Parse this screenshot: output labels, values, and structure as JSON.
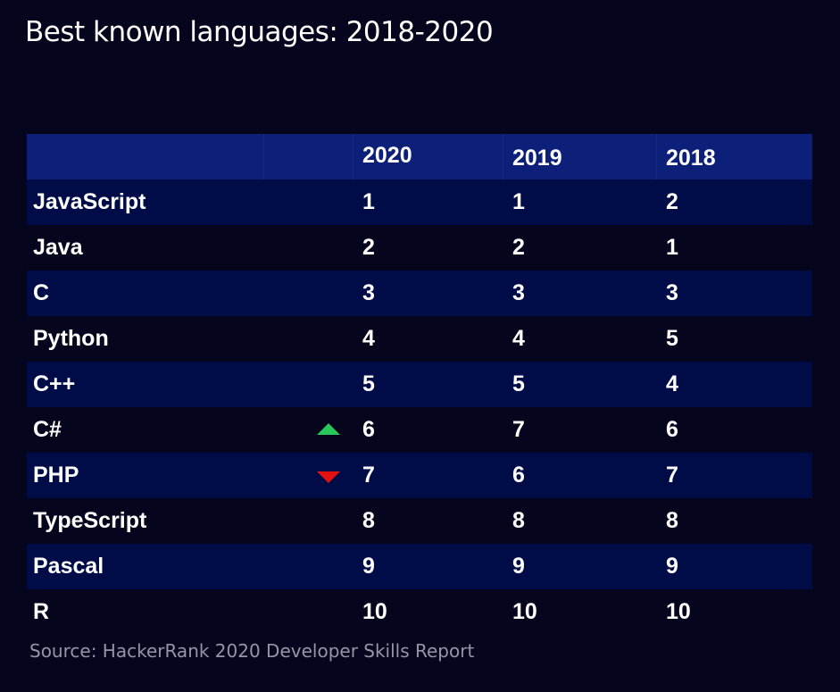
{
  "title": "Best known languages: 2018-2020",
  "source": "Source: HackerRank 2020 Developer Skills Report",
  "colors": {
    "background": "#05051e",
    "header": "#0c2079",
    "band": "#000c48",
    "up": "#27c75a",
    "down": "#e41111"
  },
  "chart_data": {
    "type": "table",
    "title": "Best known languages: 2018-2020",
    "columns": [
      "",
      "2020",
      "2019",
      "2018"
    ],
    "rows": [
      {
        "language": "JavaScript",
        "r2020": "1",
        "r2019": "1",
        "r2018": "2",
        "trend": ""
      },
      {
        "language": "Java",
        "r2020": "2",
        "r2019": "2",
        "r2018": "1",
        "trend": ""
      },
      {
        "language": "C",
        "r2020": "3",
        "r2019": "3",
        "r2018": "3",
        "trend": ""
      },
      {
        "language": "Python",
        "r2020": "4",
        "r2019": "4",
        "r2018": "5",
        "trend": ""
      },
      {
        "language": "C++",
        "r2020": "5",
        "r2019": "5",
        "r2018": "4",
        "trend": ""
      },
      {
        "language": "C#",
        "r2020": "6",
        "r2019": "7",
        "r2018": "6",
        "trend": "up"
      },
      {
        "language": "PHP",
        "r2020": "7",
        "r2019": "6",
        "r2018": "7",
        "trend": "down"
      },
      {
        "language": "TypeScript",
        "r2020": "8",
        "r2019": "8",
        "r2018": "8",
        "trend": ""
      },
      {
        "language": "Pascal",
        "r2020": "9",
        "r2019": "9",
        "r2018": "9",
        "trend": ""
      },
      {
        "language": "R",
        "r2020": "10",
        "r2019": "10",
        "r2018": "10",
        "trend": ""
      }
    ]
  }
}
